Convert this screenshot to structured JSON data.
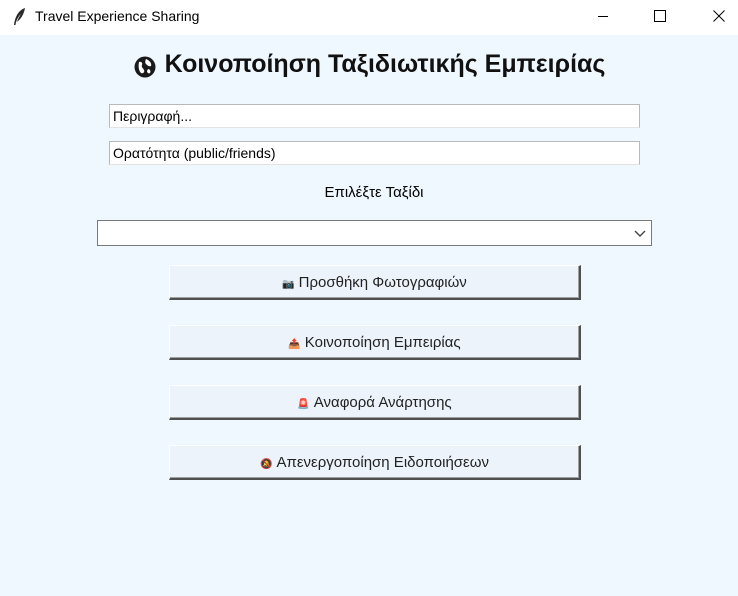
{
  "window": {
    "title": "Travel Experience Sharing",
    "minimize_icon": "minimize-icon",
    "maximize_icon": "maximize-icon",
    "close_icon": "close-icon"
  },
  "main": {
    "heading_icon": "globe-icon",
    "heading": "Κοινοποίηση Ταξιδιωτικής Εμπειρίας",
    "description_value": "Περιγραφή...",
    "visibility_value": "Ορατότητα (public/friends)",
    "trip_label": "Επιλέξτε Ταξίδι",
    "trip_selected": ""
  },
  "buttons": {
    "add_photos": {
      "icon": "camera-icon",
      "glyph": "📷",
      "label": "Προσθήκη Φωτογραφιών"
    },
    "share": {
      "icon": "share-icon",
      "glyph": "📤",
      "label": "Κοινοποίηση Εμπειρίας"
    },
    "report": {
      "icon": "report-icon",
      "glyph": "🚨",
      "label": "Αναφορά Ανάρτησης"
    },
    "disable_notifications": {
      "icon": "mute-icon",
      "glyph": "🔕",
      "label": "Απενεργοποίηση Ειδοποιήσεων"
    }
  },
  "colors": {
    "background": "#f0f8ff",
    "button_face": "#ecf3fa",
    "titlebar": "#ffffff"
  }
}
